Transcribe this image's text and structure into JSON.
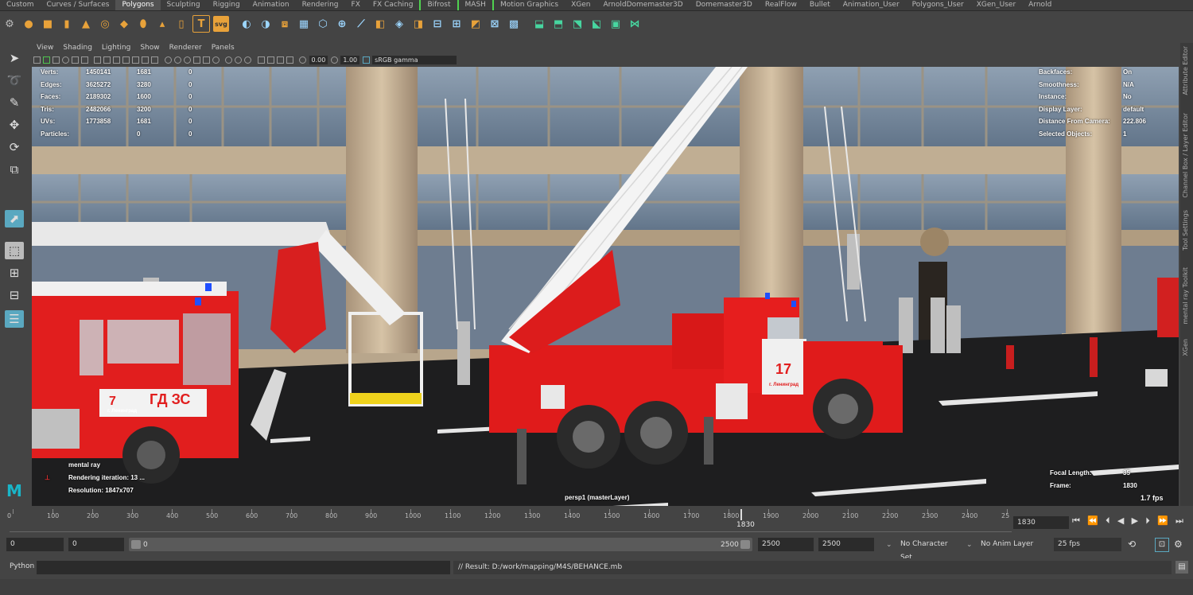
{
  "shelf": {
    "tabs": [
      "Custom",
      "Curves / Surfaces",
      "Polygons",
      "Sculpting",
      "Rigging",
      "Animation",
      "Rendering",
      "FX",
      "FX Caching",
      "Bifrost",
      "MASH",
      "Motion Graphics",
      "XGen",
      "ArnoldDomemaster3D",
      "Domemaster3D",
      "RealFlow",
      "Bullet",
      "Animation_User",
      "Polygons_User",
      "XGen_User",
      "Arnold"
    ],
    "active_tab": "Polygons",
    "text_tool_label": "T",
    "svg_tool_label": "svg"
  },
  "panel": {
    "menus": [
      "View",
      "Shading",
      "Lighting",
      "Show",
      "Renderer",
      "Panels"
    ],
    "exposure": "0.00",
    "gamma": "1.00",
    "color_space": "sRGB gamma"
  },
  "hud_left": {
    "rows": [
      {
        "label": "Verts:",
        "a": "1450141",
        "b": "1681",
        "c": "0"
      },
      {
        "label": "Edges:",
        "a": "3625272",
        "b": "3280",
        "c": "0"
      },
      {
        "label": "Faces:",
        "a": "2189302",
        "b": "1600",
        "c": "0"
      },
      {
        "label": "Tris:",
        "a": "2482066",
        "b": "3200",
        "c": "0"
      },
      {
        "label": "UVs:",
        "a": "1773858",
        "b": "1681",
        "c": "0"
      },
      {
        "label": "Particles:",
        "a": "",
        "b": "0",
        "c": "0"
      }
    ]
  },
  "hud_right": {
    "rows": [
      {
        "label": "Backfaces:",
        "value": "On"
      },
      {
        "label": "Smoothness:",
        "value": "N/A"
      },
      {
        "label": "Instance:",
        "value": "No"
      },
      {
        "label": "Display Layer:",
        "value": "default"
      },
      {
        "label": "Distance From Camera:",
        "value": "222.806"
      },
      {
        "label": "Selected Objects:",
        "value": "1"
      }
    ],
    "focal_label": "Focal Length:",
    "focal_value": "35",
    "frame_label": "Frame:",
    "frame_value": "1830",
    "fps": "1.7 fps"
  },
  "render_info": {
    "renderer": "mental ray",
    "iteration": "Rendering iteration: 13 ...",
    "resolution": "Resolution:  1847x707"
  },
  "camera_label": "persp1 (masterLayer)",
  "scene_text": {
    "bus_number": "7",
    "bus_text": "ГД ЗС",
    "bus_city": "г. Ленинград",
    "truck_number": "17",
    "truck_city": "г. Ленинград"
  },
  "right_tabs": [
    "Attribute Editor",
    "Channel Box / Layer Editor",
    "Tool Settings",
    "mental ray Toolkit",
    "XGen"
  ],
  "timeline": {
    "ticks": [
      "0",
      "100",
      "200",
      "300",
      "400",
      "500",
      "600",
      "700",
      "800",
      "900",
      "1000",
      "1100",
      "1200",
      "1300",
      "1400",
      "1500",
      "1600",
      "1700",
      "1800",
      "1900",
      "2000",
      "2100",
      "2200",
      "2300",
      "2400",
      "25"
    ],
    "current_frame_marker": "1830",
    "current_frame_field": "1830"
  },
  "range": {
    "start": "0",
    "anim_start": "0",
    "slider_start": "0",
    "slider_end": "2500",
    "end": "2500",
    "anim_end": "2500",
    "character_set": "No Character Set",
    "anim_layer": "No Anim Layer",
    "fps": "25 fps"
  },
  "command": {
    "language": "Python",
    "result": "// Result: D:/work/mapping/M4S/BEHANCE.mb"
  }
}
